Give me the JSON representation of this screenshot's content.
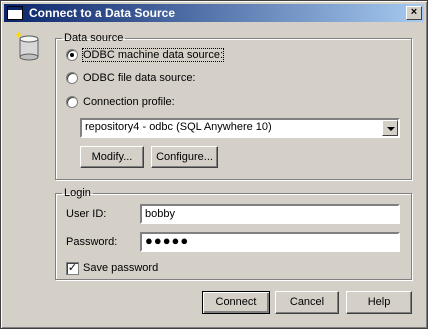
{
  "window": {
    "title": "Connect to a Data Source",
    "close_glyph": "×"
  },
  "data_source": {
    "group_label": "Data source",
    "odbc_machine_label": "ODBC machine data source:",
    "odbc_machine_checked": true,
    "odbc_file_label": "ODBC file data source:",
    "odbc_file_checked": false,
    "connection_profile_label": "Connection profile:",
    "connection_profile_checked": false,
    "selected_source": "repository4 - odbc (SQL Anywhere 10)",
    "modify_button": "Modify...",
    "configure_button": "Configure..."
  },
  "login": {
    "group_label": "Login",
    "user_id_label": "User ID:",
    "user_id_value": "bobby",
    "password_label": "Password:",
    "password_value": "●●●●●",
    "save_password_label": "Save password",
    "save_password_checked": true,
    "check_glyph": "✓"
  },
  "buttons": {
    "connect": "Connect",
    "cancel": "Cancel",
    "help": "Help"
  },
  "icons": {
    "window_icon": "application-window-icon",
    "data_source_icon": "database-cylinder-icon"
  }
}
